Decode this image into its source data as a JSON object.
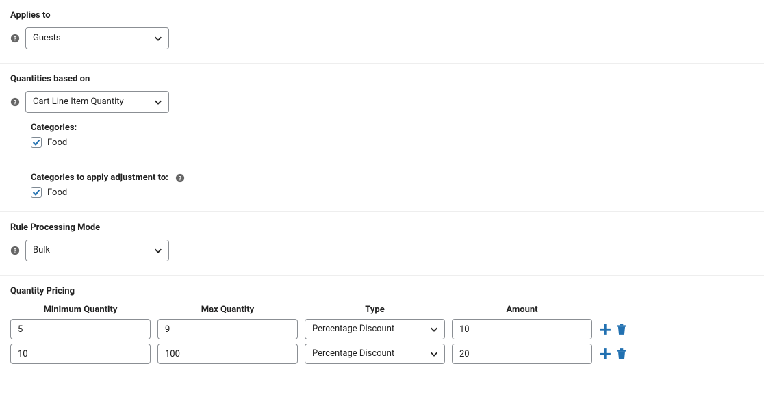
{
  "applies_to": {
    "heading": "Applies to",
    "value": "Guests"
  },
  "quantities_based_on": {
    "heading": "Quantities based on",
    "value": "Cart Line Item Quantity",
    "categories_label": "Categories:",
    "categories": {
      "food": {
        "label": "Food",
        "checked": true
      }
    }
  },
  "apply_adjustment": {
    "heading": "Categories to apply adjustment to:",
    "categories": {
      "food": {
        "label": "Food",
        "checked": true
      }
    }
  },
  "rule_processing_mode": {
    "heading": "Rule Processing Mode",
    "value": "Bulk"
  },
  "quantity_pricing": {
    "heading": "Quantity Pricing",
    "headers": {
      "min": "Minimum Quantity",
      "max": "Max Quantity",
      "type": "Type",
      "amount": "Amount"
    },
    "rows": [
      {
        "min": "5",
        "max": "9",
        "type": "Percentage Discount",
        "amount": "10"
      },
      {
        "min": "10",
        "max": "100",
        "type": "Percentage Discount",
        "amount": "20"
      }
    ]
  }
}
